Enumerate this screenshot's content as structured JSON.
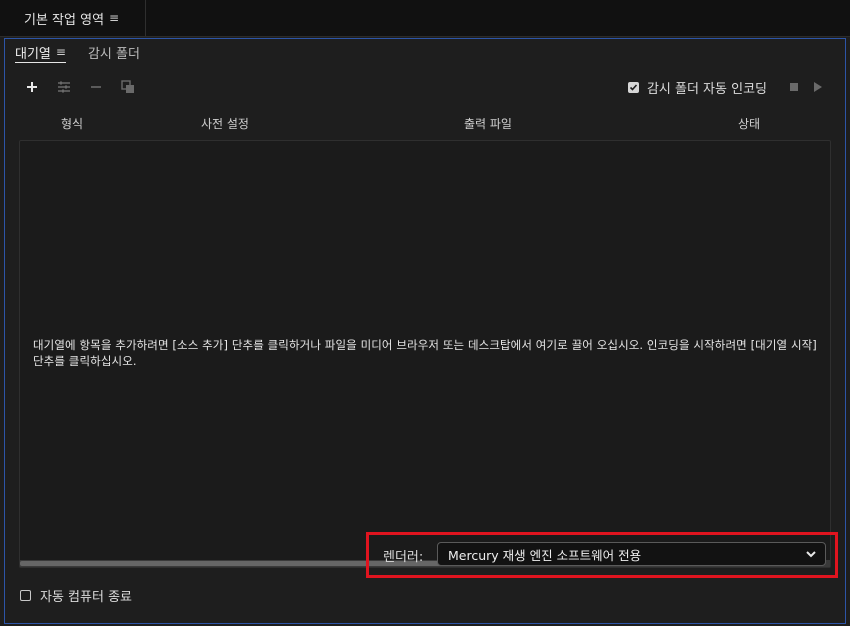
{
  "workspace": {
    "title": "기본 작업 영역",
    "menu_icon": "≡"
  },
  "tabs": [
    {
      "label": "대기열",
      "menu_icon": "≡",
      "active": true
    },
    {
      "label": "감시 폴더",
      "active": false
    }
  ],
  "toolbar": {
    "add_source": "add-icon",
    "settings": "settings-icon",
    "remove": "minus-icon",
    "duplicate": "duplicate-icon",
    "auto_encode_label": "감시 폴더 자동 인코딩",
    "auto_encode_checked": true
  },
  "columns": [
    "형식",
    "사전 설정",
    "출력 파일",
    "상태"
  ],
  "queue": {
    "empty_message": "대기열에 항목을 추가하려면 [소스 추가] 단추를 클릭하거나 파일을 미디어 브라우저 또는 데스크탑에서 여기로 끌어 오십시오. 인코딩을 시작하려면 [대기열 시작] 단추를 클릭하십시오."
  },
  "footer": {
    "auto_shutdown_label": "자동 컴퓨터 종료",
    "auto_shutdown_checked": false,
    "renderer_label": "렌더러:",
    "renderer_value": "Mercury 재생 엔진 소프트웨어 전용"
  },
  "colors": {
    "accent_border": "#2d55a8",
    "highlight": "#e0141f",
    "background": "#1e1e1e"
  }
}
